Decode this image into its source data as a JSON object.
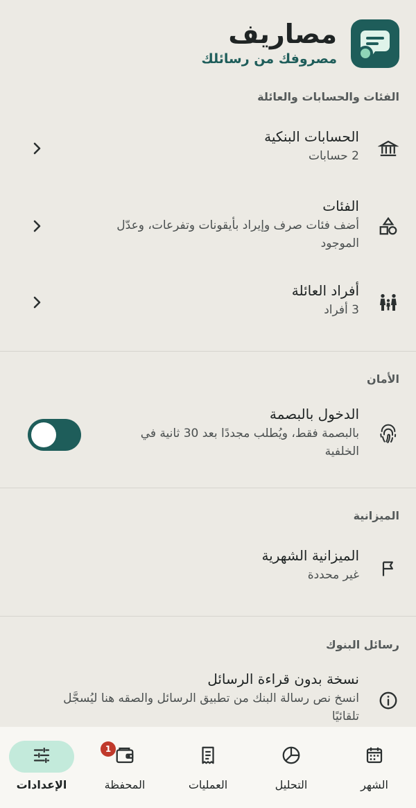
{
  "app": {
    "title": "مصاريف",
    "subtitle": "مصروفك من رسائلك",
    "logo_icon": "message-coin-icon"
  },
  "sections": {
    "categories_accounts_family": {
      "header": "الفئات والحسابات والعائلة",
      "items": [
        {
          "title": "الحسابات البنكية",
          "subtitle": "2 حسابات",
          "icon": "bank-icon"
        },
        {
          "title": "الفئات",
          "subtitle_line1": "أضف فئات صرف وإيراد بأيقونات وتفرعات، وعدّل",
          "subtitle_line2": "الموجود",
          "icon": "shapes-icon"
        },
        {
          "title": "أفراد العائلة",
          "subtitle": "3 أفراد",
          "icon": "family-icon"
        }
      ]
    },
    "security": {
      "header": "الأمان",
      "fingerprint": {
        "title": "الدخول بالبصمة",
        "subtitle_line1": "بالبصمة فقط، ويُطلب مجددًا بعد 30 ثانية في",
        "subtitle_line2": "الخلفية",
        "icon": "fingerprint-icon",
        "enabled": true
      }
    },
    "budget": {
      "header": "الميزانية",
      "monthly": {
        "title": "الميزانية الشهرية",
        "subtitle": "غير محددة",
        "icon": "flag-icon"
      }
    },
    "bank_messages": {
      "header": "رسائل البنوك",
      "copy": {
        "title": "نسخة بدون قراءة الرسائل",
        "subtitle_line1": "انسخ نص رسالة البنك من تطبيق الرسائل والصقه هنا ليُسجَّل",
        "subtitle_line2": "تلقائيًا",
        "icon": "info-icon"
      }
    }
  },
  "bottom_nav": {
    "items": [
      {
        "label": "الشهر",
        "icon": "calendar-icon"
      },
      {
        "label": "التحليل",
        "icon": "pie-chart-icon"
      },
      {
        "label": "العمليات",
        "icon": "receipt-icon"
      },
      {
        "label": "المحفظة",
        "icon": "wallet-icon",
        "badge": "1"
      },
      {
        "label": "الإعدادات",
        "icon": "sliders-icon",
        "active": true
      }
    ]
  },
  "colors": {
    "primary": "#1e5d5a",
    "background": "#eceae4",
    "active_nav": "#c3eadb",
    "badge": "#c0392b"
  }
}
